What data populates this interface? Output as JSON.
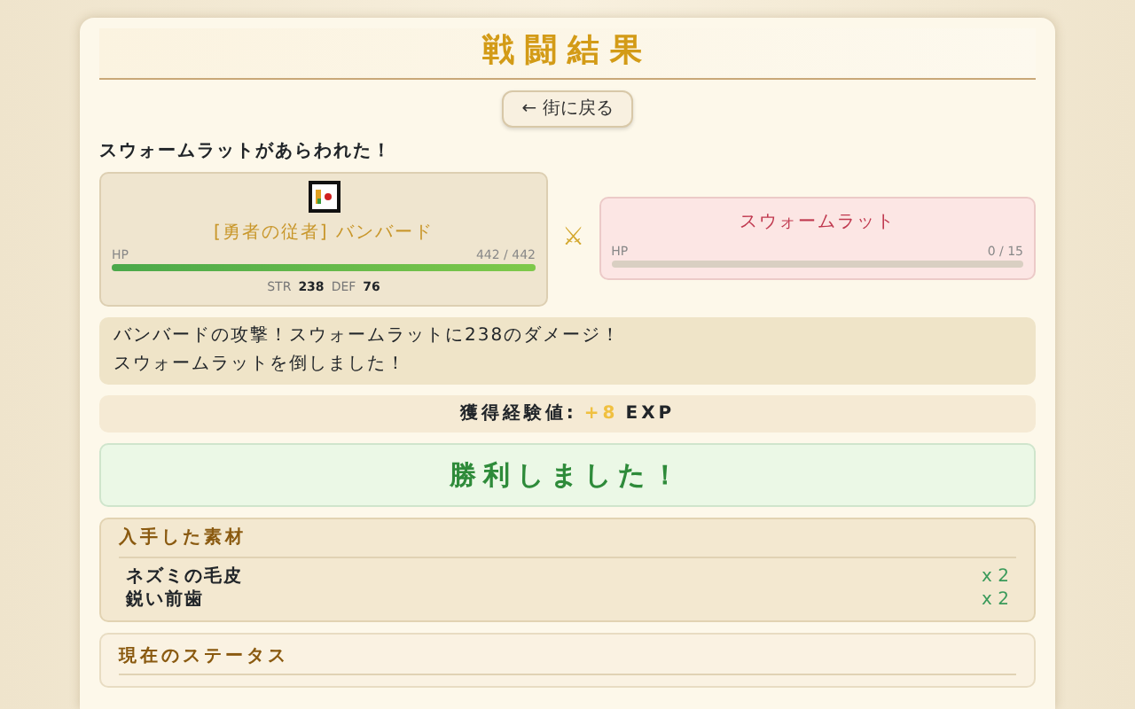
{
  "title": "戦闘結果",
  "back_button": {
    "icon": "←",
    "label": "街に戻る"
  },
  "encounter": "スウォームラットがあらわれた！",
  "player": {
    "name": "[勇者の従者] バンバード",
    "hp_label": "HP",
    "hp": "442 / 442",
    "level": 1.0,
    "str_label": "STR",
    "str": "238",
    "def_label": "DEF",
    "def": "76"
  },
  "versus": "⚔",
  "enemy": {
    "name": "スウォームラット",
    "hp_label": "HP",
    "hp": "0 / 15",
    "level": 0.0
  },
  "log": [
    "バンバードの攻撃！スウォームラットに238のダメージ！",
    "スウォームラットを倒しました！"
  ],
  "exp": {
    "label": "獲得経験値:",
    "value": "+8",
    "unit": "EXP"
  },
  "result": "勝利しました！",
  "materials": {
    "title": "入手した素材",
    "items": [
      {
        "name": "ネズミの毛皮",
        "count": "x 2"
      },
      {
        "name": "鋭い前歯",
        "count": "x 2"
      }
    ]
  },
  "status": {
    "title": "現在のステータス"
  }
}
